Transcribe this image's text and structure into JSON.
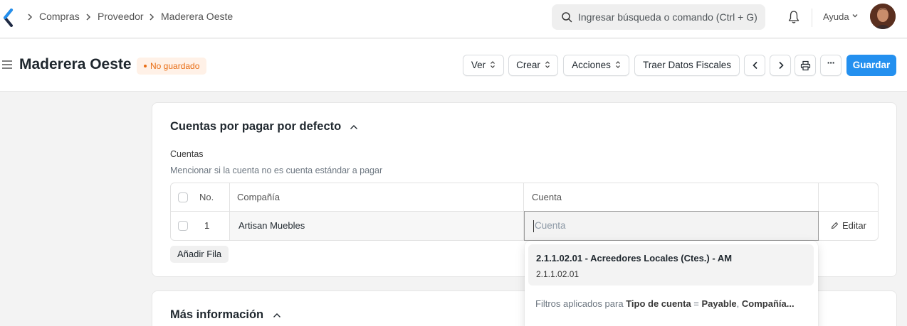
{
  "navbar": {
    "breadcrumbs": [
      "Compras",
      "Proveedor",
      "Maderera Oeste"
    ],
    "search_placeholder": "Ingresar búsqueda o comando (Ctrl + G)",
    "help_label": "Ayuda"
  },
  "page": {
    "title": "Maderera Oeste",
    "status_badge": "No guardado",
    "buttons": {
      "view": "Ver",
      "create": "Crear",
      "actions": "Acciones",
      "fiscal": "Traer Datos Fiscales",
      "save": "Guardar"
    },
    "more_label": "···"
  },
  "section_accounts": {
    "title": "Cuentas por pagar por defecto",
    "field_label": "Cuentas",
    "description": "Mencionar si la cuenta no es cuenta estándar a pagar",
    "table": {
      "headers": {
        "no": "No.",
        "company": "Compañía",
        "account": "Cuenta"
      },
      "rows": [
        {
          "no": "1",
          "company": "Artisan Muebles",
          "account_placeholder": "Cuenta",
          "edit": "Editar"
        }
      ]
    },
    "add_row": "Añadir Fila"
  },
  "dropdown": {
    "item_title": "2.1.1.02.01 - Acreedores Locales (Ctes.) - AM",
    "item_sub": "2.1.1.02.01",
    "filter_prefix": "Filtros aplicados para",
    "filter_field1": "Tipo de cuenta",
    "filter_eq": " = ",
    "filter_value1": "Payable",
    "filter_sep": ", ",
    "filter_field2": "Compañía..."
  },
  "section_more": {
    "title": "Más información"
  },
  "colors": {
    "primary": "#2490ef",
    "badge_text": "#e86c13",
    "badge_bg": "#fff1e7"
  }
}
